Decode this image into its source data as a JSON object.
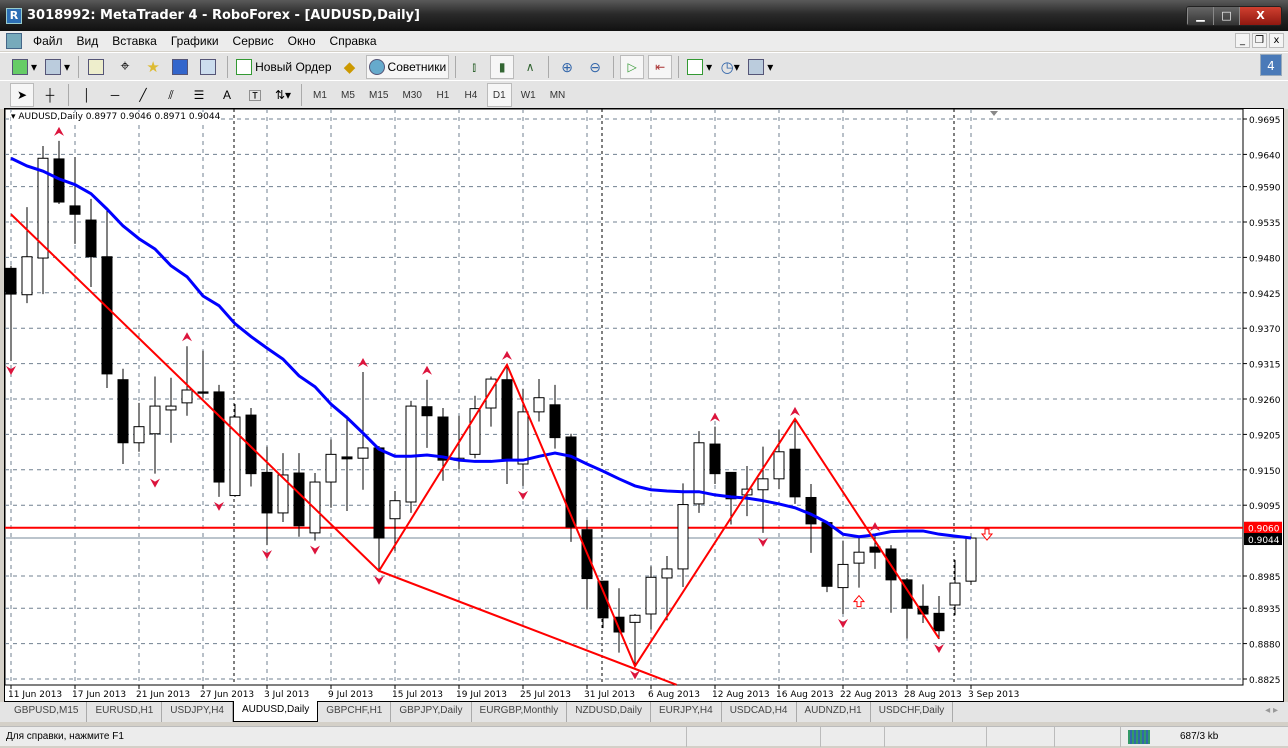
{
  "window": {
    "title": "3018992: MetaTrader 4 - RoboForex - [AUDUSD,Daily]",
    "icon": "app-icon"
  },
  "menu": [
    "Файл",
    "Вид",
    "Вставка",
    "Графики",
    "Сервис",
    "Окно",
    "Справка"
  ],
  "toolbar": {
    "new_order": "Новый Ордер",
    "experts": "Советники",
    "notifications": "4"
  },
  "timeframes": [
    "M1",
    "M5",
    "M15",
    "M30",
    "H1",
    "H4",
    "D1",
    "W1",
    "MN"
  ],
  "active_timeframe": "D1",
  "chart": {
    "symbol_info": "AUDUSD,Daily  0.8977 0.9046 0.8971 0.9044"
  },
  "colors": {
    "ma": "#0000ff",
    "zigzag": "#ff0000",
    "bid_label": "#000000",
    "level_label": "#ff0000"
  },
  "chart_data": {
    "type": "candlestick",
    "symbol": "AUDUSD",
    "timeframe": "Daily",
    "ohlc_last": {
      "open": 0.8977,
      "high": 0.9046,
      "low": 0.8971,
      "close": 0.9044
    },
    "y_ticks": [
      "0.9695",
      "0.9640",
      "0.9590",
      "0.9535",
      "0.9480",
      "0.9425",
      "0.9370",
      "0.9315",
      "0.9260",
      "0.9205",
      "0.9150",
      "0.9095",
      "0.8985",
      "0.8935",
      "0.8880",
      "0.8825"
    ],
    "ylim": [
      0.8825,
      0.9695
    ],
    "x_labels": [
      "11 Jun 2013",
      "17 Jun 2013",
      "21 Jun 2013",
      "27 Jun 2013",
      "3 Jul 2013",
      "9 Jul 2013",
      "15 Jul 2013",
      "19 Jul 2013",
      "25 Jul 2013",
      "31 Jul 2013",
      "6 Aug 2013",
      "12 Aug 2013",
      "16 Aug 2013",
      "22 Aug 2013",
      "28 Aug 2013",
      "3 Sep 2013"
    ],
    "x_label_every_bars": 4,
    "level_line": {
      "price": 0.906,
      "label": "0.9060"
    },
    "bid_line": {
      "price": 0.9044,
      "label": "0.9044"
    },
    "period_separators": [
      14,
      37,
      59
    ],
    "candles": [
      [
        0.9463,
        0.9467,
        0.9319,
        0.9423
      ],
      [
        0.9422,
        0.9558,
        0.9409,
        0.9481
      ],
      [
        0.9479,
        0.9653,
        0.9423,
        0.9634
      ],
      [
        0.9633,
        0.9661,
        0.9563,
        0.9566
      ],
      [
        0.956,
        0.9636,
        0.9501,
        0.9547
      ],
      [
        0.9538,
        0.9571,
        0.9434,
        0.9481
      ],
      [
        0.9481,
        0.9555,
        0.9277,
        0.9299
      ],
      [
        0.929,
        0.9307,
        0.9159,
        0.9192
      ],
      [
        0.9192,
        0.9254,
        0.9178,
        0.9217
      ],
      [
        0.9206,
        0.9295,
        0.9144,
        0.9249
      ],
      [
        0.9243,
        0.9293,
        0.9192,
        0.9249
      ],
      [
        0.9254,
        0.9342,
        0.9234,
        0.9274
      ],
      [
        0.9271,
        0.9335,
        0.9262,
        0.9269
      ],
      [
        0.9271,
        0.9282,
        0.9108,
        0.9131
      ],
      [
        0.911,
        0.9252,
        0.9108,
        0.9232
      ],
      [
        0.9235,
        0.9246,
        0.9124,
        0.9144
      ],
      [
        0.9146,
        0.9186,
        0.9033,
        0.9083
      ],
      [
        0.9083,
        0.9176,
        0.9069,
        0.9142
      ],
      [
        0.9145,
        0.9176,
        0.9046,
        0.9063
      ],
      [
        0.9052,
        0.9145,
        0.904,
        0.9131
      ],
      [
        0.9131,
        0.9197,
        0.9091,
        0.9174
      ],
      [
        0.917,
        0.9234,
        0.9086,
        0.9167
      ],
      [
        0.9168,
        0.9302,
        0.9119,
        0.9184
      ],
      [
        0.9184,
        0.9187,
        0.8993,
        0.9044
      ],
      [
        0.9074,
        0.9117,
        0.9024,
        0.9102
      ],
      [
        0.91,
        0.9257,
        0.9083,
        0.9249
      ],
      [
        0.9248,
        0.929,
        0.9184,
        0.9234
      ],
      [
        0.9232,
        0.9246,
        0.9133,
        0.9165
      ],
      [
        0.9165,
        0.9234,
        0.9151,
        0.9168
      ],
      [
        0.9174,
        0.9265,
        0.9168,
        0.9245
      ],
      [
        0.9246,
        0.9295,
        0.9217,
        0.9291
      ],
      [
        0.929,
        0.9313,
        0.9128,
        0.9167
      ],
      [
        0.9159,
        0.9276,
        0.9125,
        0.924
      ],
      [
        0.924,
        0.9291,
        0.9225,
        0.9262
      ],
      [
        0.9251,
        0.9282,
        0.9183,
        0.92
      ],
      [
        0.9201,
        0.9206,
        0.9038,
        0.9061
      ],
      [
        0.9057,
        0.9072,
        0.8933,
        0.8981
      ],
      [
        0.8977,
        0.8977,
        0.8904,
        0.892
      ],
      [
        0.8921,
        0.8966,
        0.8866,
        0.8898
      ],
      [
        0.8913,
        0.8926,
        0.8846,
        0.8924
      ],
      [
        0.8926,
        0.9,
        0.8902,
        0.8983
      ],
      [
        0.8982,
        0.9016,
        0.8916,
        0.8996
      ],
      [
        0.8996,
        0.9129,
        0.8968,
        0.9096
      ],
      [
        0.9097,
        0.921,
        0.9083,
        0.9192
      ],
      [
        0.919,
        0.9217,
        0.9128,
        0.9144
      ],
      [
        0.9146,
        0.9146,
        0.9065,
        0.9105
      ],
      [
        0.9111,
        0.9156,
        0.9078,
        0.912
      ],
      [
        0.9119,
        0.9186,
        0.9052,
        0.9136
      ],
      [
        0.9136,
        0.9212,
        0.912,
        0.9178
      ],
      [
        0.9182,
        0.9226,
        0.9097,
        0.9108
      ],
      [
        0.9107,
        0.9128,
        0.9021,
        0.9066
      ],
      [
        0.9068,
        0.9068,
        0.896,
        0.8969
      ],
      [
        0.8967,
        0.904,
        0.8926,
        0.9003
      ],
      [
        0.9005,
        0.9044,
        0.8967,
        0.9022
      ],
      [
        0.903,
        0.9047,
        0.8996,
        0.9022
      ],
      [
        0.9027,
        0.9033,
        0.8928,
        0.8979
      ],
      [
        0.8979,
        0.8982,
        0.8888,
        0.8935
      ],
      [
        0.8938,
        0.8972,
        0.8912,
        0.8926
      ],
      [
        0.8927,
        0.8954,
        0.8887,
        0.89
      ],
      [
        0.894,
        0.901,
        0.8924,
        0.8974
      ],
      [
        0.8977,
        0.9046,
        0.8971,
        0.9044
      ]
    ],
    "moving_average": [
      0.9634,
      0.9622,
      0.9614,
      0.9602,
      0.9593,
      0.9579,
      0.9555,
      0.9529,
      0.9509,
      0.9493,
      0.9467,
      0.945,
      0.942,
      0.9405,
      0.9377,
      0.9357,
      0.9339,
      0.9322,
      0.9296,
      0.9279,
      0.9252,
      0.9231,
      0.9207,
      0.9182,
      0.9171,
      0.9171,
      0.9173,
      0.917,
      0.9165,
      0.9163,
      0.9163,
      0.9165,
      0.9165,
      0.9171,
      0.9176,
      0.9171,
      0.9159,
      0.9148,
      0.9136,
      0.9125,
      0.9119,
      0.9117,
      0.9116,
      0.9116,
      0.9111,
      0.9108,
      0.9106,
      0.9102,
      0.9097,
      0.9091,
      0.9081,
      0.9068,
      0.905,
      0.9046,
      0.9049,
      0.9054,
      0.9055,
      0.9055,
      0.905,
      0.9047,
      0.9044
    ],
    "zigzag": [
      [
        0,
        0.9547
      ],
      [
        23,
        0.8993
      ],
      [
        31,
        0.9313
      ],
      [
        39,
        0.8845
      ],
      [
        49,
        0.9229
      ],
      [
        58,
        0.8888
      ]
    ],
    "trendline": [
      [
        23,
        0.8993
      ],
      [
        41.6,
        0.8816
      ]
    ],
    "fractals_up": [
      3,
      11,
      22,
      26,
      31,
      44,
      49,
      54
    ],
    "fractals_down": [
      0,
      9,
      13,
      16,
      19,
      23,
      32,
      39,
      47,
      52,
      58
    ],
    "signal_buy": [
      53
    ],
    "signal_sell": [
      60
    ]
  },
  "tabs": [
    "GBPUSD,M15",
    "EURUSD,H1",
    "USDJPY,H4",
    "AUDUSD,Daily",
    "GBPCHF,H1",
    "GBPJPY,Daily",
    "EURGBP,Monthly",
    "NZDUSD,Daily",
    "EURJPY,H4",
    "USDCAD,H4",
    "AUDNZD,H1",
    "USDCHF,Daily"
  ],
  "active_tab": "AUDUSD,Daily",
  "status": {
    "help": "Для справки, нажмите F1",
    "traffic": "687/3 kb"
  }
}
